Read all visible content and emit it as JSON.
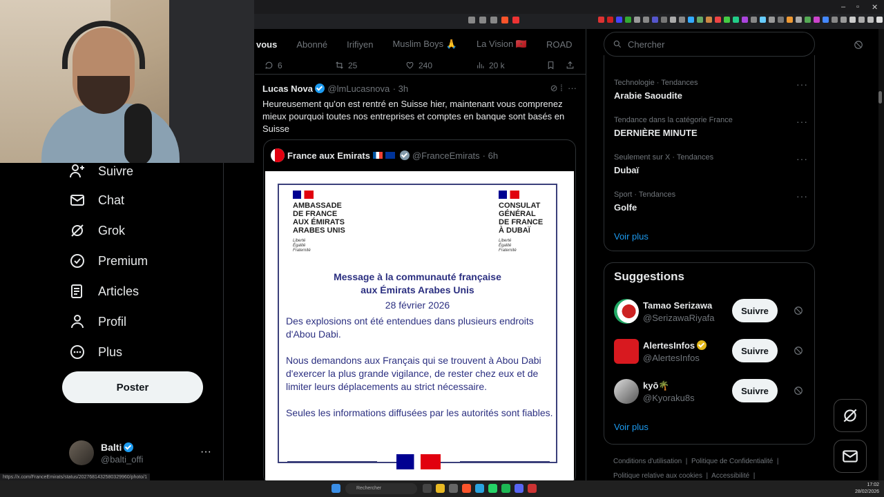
{
  "browser": {
    "controls": {
      "minimize": "–",
      "maximize": "▫",
      "close": "✕"
    }
  },
  "center": {
    "tabs": [
      "vous",
      "Abonné",
      "Irifiyen",
      "Muslim Boys 🙏",
      "La Vision 🇲🇦",
      "ROAD"
    ],
    "prev_actions": {
      "replies": "6",
      "reposts": "25",
      "likes": "240",
      "views": "20 k"
    },
    "tweet": {
      "author": "Lucas Nova",
      "handle": "@lmLucasnova",
      "time": "· 3h",
      "text": "Heureusement qu'on est rentré en Suisse hier, maintenant vous comprenez mieux pourquoi toutes nos entreprises et comptes en banque sont basés en Suisse"
    },
    "quote": {
      "author": "France aux Emirats",
      "handle": "@FranceEmirats",
      "time": "· 6h",
      "doc": {
        "left_header": [
          "AMBASSADE",
          "DE FRANCE",
          "AUX ÉMIRATS",
          "ARABES UNIS"
        ],
        "right_header": [
          "CONSULAT",
          "GÉNÉRAL",
          "DE FRANCE",
          "À DUBAÏ"
        ],
        "devise": [
          "Liberté",
          "Égalité",
          "Fraternité"
        ],
        "title_line1": "Message à la communauté française",
        "title_line2": "aux Émirats Arabes Unis",
        "date": "28 février 2026",
        "para1": "Des explosions ont été entendues dans plusieurs endroits d'Abou Dabi.",
        "para2": "Nous demandons aux Français qui se trouvent à Abou Dabi d'exercer la plus grande vigilance, de rester chez eux et de limiter leurs déplacements au strict nécessaire.",
        "para3": "Seules les informations diffusées par les autorités sont fiables."
      }
    }
  },
  "left_nav": {
    "items": [
      {
        "label": "Suivre",
        "icon": "person-plus-icon"
      },
      {
        "label": "Chat",
        "icon": "mail-icon"
      },
      {
        "label": "Grok",
        "icon": "grok-icon"
      },
      {
        "label": "Premium",
        "icon": "verified-badge-icon"
      },
      {
        "label": "Articles",
        "icon": "article-icon"
      },
      {
        "label": "Profil",
        "icon": "person-icon"
      },
      {
        "label": "Plus",
        "icon": "more-circle-icon"
      }
    ],
    "post_button": "Poster",
    "account": {
      "name": "Balti",
      "handle": "@balti_offi",
      "more": "···"
    }
  },
  "right": {
    "search_placeholder": "Chercher",
    "trends": [
      {
        "meta": "Technologie · Tendances",
        "name": "Arabie Saoudite"
      },
      {
        "meta": "Tendance dans la catégorie France",
        "name": "DERNIÈRE MINUTE"
      },
      {
        "meta": "Seulement sur X · Tendances",
        "name": "Dubaï"
      },
      {
        "meta": "Sport · Tendances",
        "name": "Golfe"
      }
    ],
    "trends_more": "Voir plus",
    "suggestions_title": "Suggestions",
    "suggestions": [
      {
        "name": "Tamao Serizawa",
        "handle": "@SerizawaRiyafa",
        "button": "Suivre"
      },
      {
        "name": "AlertesInfos",
        "handle": "@AlertesInfos",
        "button": "Suivre"
      },
      {
        "name": "kyō🌴",
        "handle": "@Kyoraku8s",
        "button": "Suivre"
      }
    ],
    "suggestions_more": "Voir plus",
    "footer": [
      "Conditions d'utilisation",
      "|",
      "Politique de Confidentialité",
      "|",
      "Politique relative aux cookies",
      "|",
      "Accessibilité",
      "|"
    ]
  },
  "status_url": "https://x.com/FranceEmirats/status/2027681432580329960/photo/1",
  "taskbar": {
    "search": "Rechercher",
    "time": "17:02",
    "date": "28/02/2026"
  },
  "colors": {
    "accent": "#1d9bf0",
    "background": "#000000",
    "muted": "#71767b",
    "doc_blue": "#2b2f80"
  }
}
